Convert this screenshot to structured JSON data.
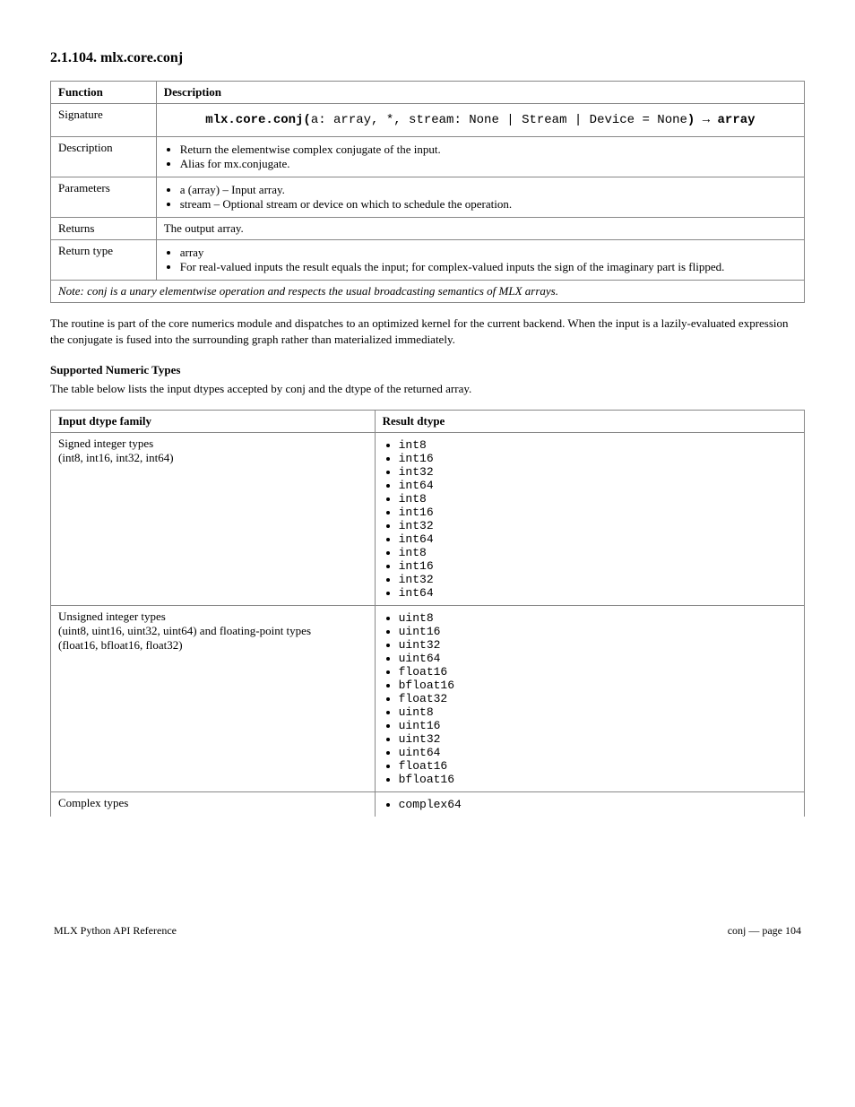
{
  "section1": {
    "title": "2.1.104. mlx.core.conj",
    "table": {
      "header_left": "Function",
      "header_right": "Description",
      "signature_row": {
        "left": "Signature",
        "sig_prefix": "mlx.core.conj(",
        "sig_args": "a: array, *, stream: None | Stream | Device = None",
        "sig_suffix": ") → array"
      },
      "rows": [
        {
          "left": "Description",
          "bullets": [
            "Return the elementwise complex conjugate of the input.",
            "Alias for mx.conjugate."
          ]
        },
        {
          "left": "Parameters",
          "bullets": [
            "a (array) – Input array.",
            "stream – Optional stream or device on which to schedule the operation."
          ]
        },
        {
          "left": "Returns",
          "text": "The output array."
        },
        {
          "left": "Return type",
          "bullets": [
            "array",
            "For real-valued inputs the result equals the input; for complex-valued inputs the sign of the imaginary part is flipped."
          ]
        }
      ],
      "note": "Note: conj is a unary elementwise operation and respects the usual broadcasting semantics of MLX arrays."
    }
  },
  "para1": "The routine is part of the core numerics module and dispatches to an optimized kernel for the current backend. When the input is a lazily-evaluated expression the conjugate is fused into the surrounding graph rather than materialized immediately.",
  "subhead": "Supported Numeric Types",
  "para2": "The table below lists the input dtypes accepted by conj and the dtype of the returned array.",
  "section2": {
    "table": {
      "header_left": "Input dtype family",
      "header_right": "Result dtype",
      "rows": [
        {
          "left": "Signed integer types\n(int8, int16, int32, int64)",
          "bullets": [
            "int8",
            "int16",
            "int32",
            "int64",
            "int8",
            "int16",
            "int32",
            "int64",
            "int8",
            "int16",
            "int32",
            "int64"
          ]
        },
        {
          "left": "Unsigned integer types\n(uint8, uint16, uint32, uint64) and floating-point types\n(float16, bfloat16, float32)",
          "bullets": [
            "uint8",
            "uint16",
            "uint32",
            "uint64",
            "float16",
            "bfloat16",
            "float32",
            "uint8",
            "uint16",
            "uint32",
            "uint64",
            "float16",
            "bfloat16"
          ]
        },
        {
          "left": "Complex types",
          "bullets": [
            "complex64"
          ]
        }
      ]
    }
  },
  "footer": {
    "left": "MLX Python API Reference",
    "right": "conj — page 104"
  }
}
